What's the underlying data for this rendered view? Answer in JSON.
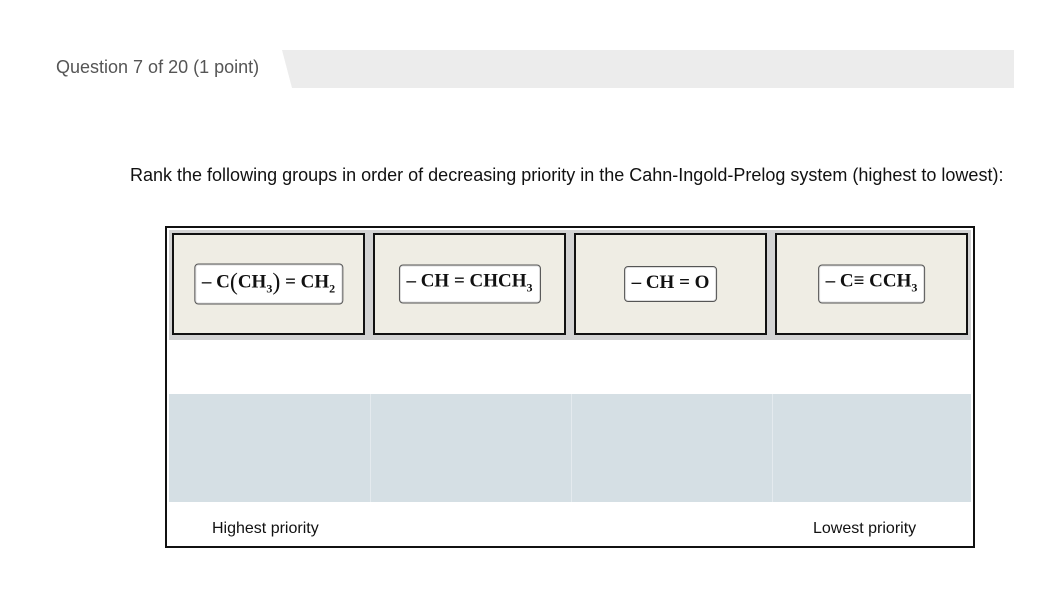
{
  "question": {
    "header": "Question 7 of 20 (1 point)",
    "prompt": "Rank the following groups in order of decreasing priority in the Cahn-Ingold-Prelog system (highest to lowest):"
  },
  "ranking": {
    "groups": [
      {
        "formula": "– C(CH3) = CH2"
      },
      {
        "formula": "– CH = CHCH3"
      },
      {
        "formula": "– CH = O"
      },
      {
        "formula": "– C≡ CCH3"
      }
    ],
    "drop_slot_count": 4,
    "highest_label": "Highest priority",
    "lowest_label": "Lowest priority"
  },
  "colors": {
    "header_bar": "#ececec",
    "card_background": "#efede4",
    "source_row": "#d3d3d3",
    "drop_row": "#d5dfe4"
  }
}
